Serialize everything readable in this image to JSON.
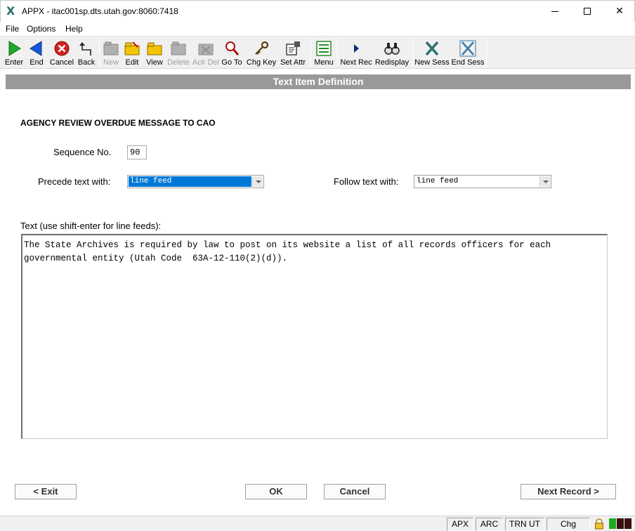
{
  "window": {
    "title": "APPX - itac001sp.dts.utah.gov:8060:7418",
    "app_icon": "appx-x-icon"
  },
  "menu": [
    "File",
    "Options",
    "Help"
  ],
  "toolbar": [
    {
      "label": "Enter",
      "icon": "play-green-icon",
      "enabled": true
    },
    {
      "label": "End",
      "icon": "arrow-left-blue-icon",
      "enabled": true
    },
    {
      "label": "Cancel",
      "icon": "cancel-red-icon",
      "enabled": true
    },
    {
      "label": "Back",
      "icon": "back-arrow-icon",
      "enabled": true
    },
    {
      "label": "New",
      "icon": "new-folder-icon",
      "enabled": false
    },
    {
      "label": "Edit",
      "icon": "edit-folder-icon",
      "enabled": true
    },
    {
      "label": "View",
      "icon": "view-folder-icon",
      "enabled": true
    },
    {
      "label": "Delete",
      "icon": "delete-folder-icon",
      "enabled": false
    },
    {
      "label": "Ack Del",
      "icon": "ack-delete-icon",
      "enabled": false
    },
    {
      "label": "Go To",
      "icon": "magnifier-icon",
      "enabled": true
    },
    {
      "label": "Chg Key",
      "icon": "key-icon",
      "enabled": true
    },
    {
      "label": "Set Attr",
      "icon": "set-attr-icon",
      "enabled": true
    },
    {
      "label": "Menu",
      "icon": "menu-list-icon",
      "enabled": true
    },
    {
      "label": "Next Rec",
      "icon": "next-triangle-icon",
      "enabled": true
    },
    {
      "label": "Redisplay",
      "icon": "binoculars-icon",
      "enabled": true
    },
    {
      "label": "New Sess",
      "icon": "new-session-icon",
      "enabled": true
    },
    {
      "label": "End Sess",
      "icon": "end-session-icon",
      "enabled": true
    }
  ],
  "header": "Text Item Definition",
  "heading": "AGENCY REVIEW OVERDUE MESSAGE TO CAO",
  "form": {
    "sequence_label": "Sequence No.",
    "sequence_value": "90",
    "precede_label": "Precede text with:",
    "precede_value": "line feed",
    "follow_label": "Follow text with:",
    "follow_value": "line feed",
    "text_label": "Text (use shift-enter for line feeds):",
    "text_value": "The State Archives is required by law to post on its website a list of all records officers for each\ngovernmental entity (Utah Code  63A-12-110(2)(d))."
  },
  "buttons": {
    "exit": "< Exit",
    "ok": "OK",
    "cancel": "Cancel",
    "next_record": "Next Record >"
  },
  "status": [
    "APX",
    "ARC",
    "TRN UT",
    "Chg"
  ],
  "colors": {
    "header_bg": "#999999",
    "select_highlight": "#0078d7"
  }
}
